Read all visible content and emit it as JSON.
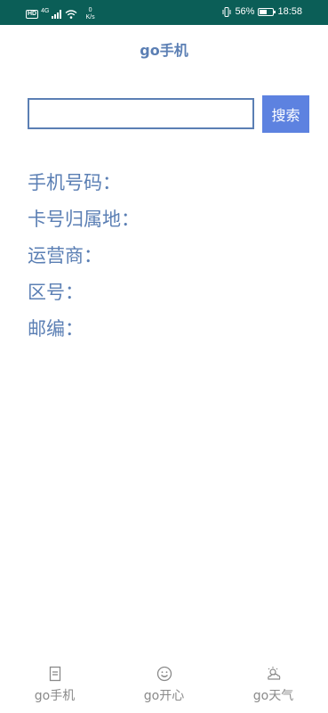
{
  "status_bar": {
    "hd": "HD",
    "network_type": "4G",
    "speed_value": "0",
    "speed_unit": "K/s",
    "battery_percent": "56%",
    "battery_level": 0.56,
    "time": "18:58"
  },
  "app": {
    "title": "go手机"
  },
  "search": {
    "value": "",
    "placeholder": "",
    "button_label": "搜索"
  },
  "info": {
    "phone_number_label": "手机号码：",
    "card_location_label": "卡号归属地：",
    "carrier_label": "运营商：",
    "area_code_label": "区号：",
    "postal_code_label": "邮编："
  },
  "bottom_nav": {
    "items": [
      {
        "label": "go手机",
        "icon": "phone-list-icon"
      },
      {
        "label": "go开心",
        "icon": "smile-icon"
      },
      {
        "label": "go天气",
        "icon": "weather-icon"
      }
    ]
  },
  "colors": {
    "status_bar": "#0b5e57",
    "accent_text": "#5b7fb4",
    "button": "#5d82e0",
    "nav_text": "#8a8a8a"
  }
}
